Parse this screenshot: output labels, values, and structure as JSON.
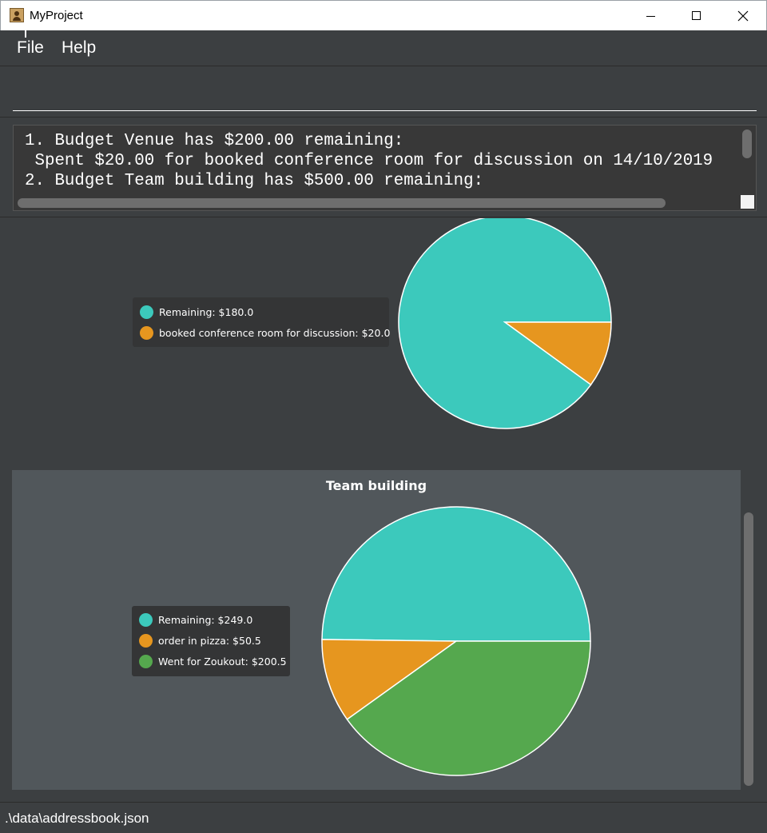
{
  "window": {
    "title": "MyProject"
  },
  "menu": {
    "file": "File",
    "help": "Help"
  },
  "command": {
    "value": ""
  },
  "result": {
    "lines": [
      "1. Budget Venue has $200.00 remaining:",
      " Spent $20.00 for booked conference room for discussion on 14/10/2019",
      "2. Budget Team building has $500.00 remaining:"
    ]
  },
  "colors": {
    "teal": "#3cc9bc",
    "orange": "#e6961f",
    "green": "#55a84e"
  },
  "charts": [
    {
      "title": "",
      "legend": [
        {
          "label": "Remaining: $180.0",
          "color": "#3cc9bc"
        },
        {
          "label": "booked conference room for discussion: $20.0",
          "color": "#e6961f"
        }
      ]
    },
    {
      "title": "Team building",
      "legend": [
        {
          "label": "Remaining: $249.0",
          "color": "#3cc9bc"
        },
        {
          "label": "order in pizza: $50.5",
          "color": "#e6961f"
        },
        {
          "label": "Went for Zoukout: $200.5",
          "color": "#55a84e"
        }
      ]
    }
  ],
  "chart_data": [
    {
      "type": "pie",
      "title": "",
      "labels": [
        "Remaining",
        "booked conference room for discussion"
      ],
      "values": [
        180.0,
        20.0
      ],
      "colors": [
        "#3cc9bc",
        "#e6961f"
      ]
    },
    {
      "type": "pie",
      "title": "Team building",
      "labels": [
        "Remaining",
        "order in pizza",
        "Went for Zoukout"
      ],
      "values": [
        249.0,
        50.5,
        200.5
      ],
      "colors": [
        "#3cc9bc",
        "#e6961f",
        "#55a84e"
      ]
    }
  ],
  "status": {
    "path": ".\\data\\addressbook.json"
  }
}
